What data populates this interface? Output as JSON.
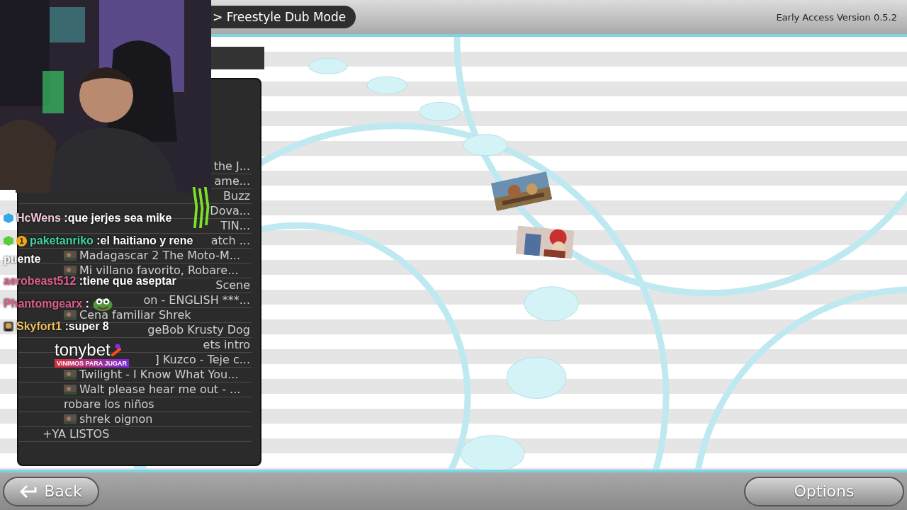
{
  "header": {
    "breadcrumb": "> Freestyle Dub Mode",
    "version": "Early Access Version 0.5.2"
  },
  "clip_list": {
    "items": [
      {
        "text": "the J...",
        "kind": "cut"
      },
      {
        "text": "ame...",
        "kind": "cut"
      },
      {
        "text": "Buzz",
        "kind": "cut"
      },
      {
        "text": "Dova...",
        "kind": "cut"
      },
      {
        "text": "TIN...",
        "kind": "cut"
      },
      {
        "text": "atch ...",
        "kind": "cut"
      },
      {
        "text": "Madagascar 2 The Moto-M...",
        "kind": "clip"
      },
      {
        "text": "Mi villano favorito, Robare...",
        "kind": "clip"
      },
      {
        "text": "Scene",
        "kind": "covered"
      },
      {
        "text": "on - ENGLISH ***...",
        "kind": "covered"
      },
      {
        "text": "Cena familiar Shrek",
        "kind": "clip"
      },
      {
        "text": "geBob Krusty Dog",
        "kind": "covered"
      },
      {
        "text": "ets intro",
        "kind": "covered"
      },
      {
        "text": "] Kuzco - Teje c...",
        "kind": "covered"
      },
      {
        "text": "Twilight - I Know What You...",
        "kind": "clip"
      },
      {
        "text": "Walt please hear me out - ...",
        "kind": "clip"
      },
      {
        "text": "robare los niños",
        "kind": "plain"
      },
      {
        "text": "shrek oignon",
        "kind": "clip"
      },
      {
        "text": "+YA LISTOS",
        "kind": "folder"
      }
    ]
  },
  "stream_overlay": {
    "chat": [
      {
        "user": "HcWens",
        "color": "#f3c9de",
        "separator": ":",
        "message_lines": [
          "que jerjes sea mike"
        ],
        "badges": [
          {
            "kind": "cube",
            "color": "#35a8e8"
          }
        ]
      },
      {
        "user": "paketanriko",
        "color": "#3fd6a0",
        "separator": ":",
        "message_lines": [
          "el haitiano y rene",
          "puente"
        ],
        "badges": [
          {
            "kind": "cube",
            "color": "#5ccc3a"
          },
          {
            "kind": "sub",
            "text": "1"
          }
        ]
      },
      {
        "user": "aerobeast512",
        "color": "#e0608e",
        "separator": ":",
        "message_lines": [
          "tiene que aseptar"
        ]
      },
      {
        "user": "Phantomgearx",
        "color": "#e0608e",
        "separator": ":",
        "emote": true
      },
      {
        "user": "Skyfort1",
        "color": "#f0c060",
        "separator": ":",
        "message_lines": [
          "super 8"
        ],
        "badges": [
          {
            "kind": "avatar"
          }
        ]
      }
    ],
    "sponsor": {
      "name": "tonybet",
      "tagline": "VINIMOS PARA JUGAR"
    }
  },
  "footer": {
    "back": "Back",
    "options": "Options"
  }
}
